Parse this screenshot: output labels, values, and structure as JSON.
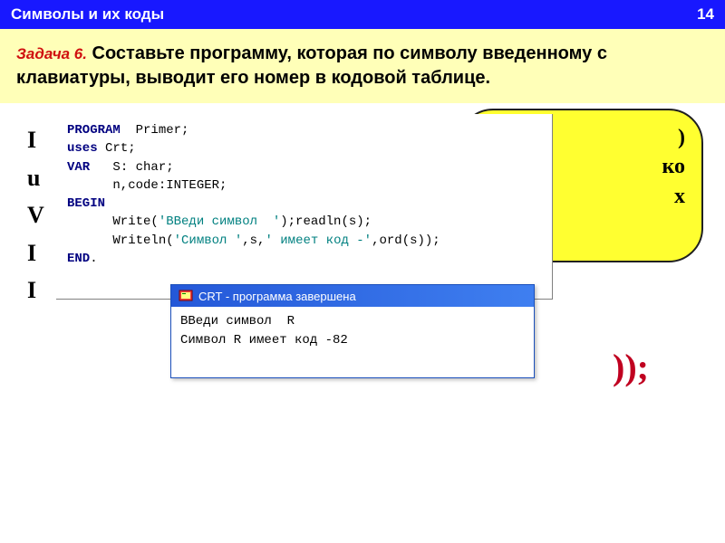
{
  "titleBar": {
    "title": "Символы  и их коды",
    "page": "14"
  },
  "task": {
    "prefix": "Задача 6.",
    "text": " Составьте программу, которая по символу введенному с клавиатуры, выводит его номер в кодовой таблице."
  },
  "behindLeft": {
    "l1": "I",
    "l2": "u",
    "l3": "V",
    "l4": "",
    "l5": "I",
    "l6": "",
    "l7": "I"
  },
  "bubble": {
    "l1": ")",
    "l2": "ко",
    "l3": "",
    "l4": "х"
  },
  "paren": "));",
  "code": {
    "line1_kw": "PROGRAM",
    "line1_rest": "  Primer;",
    "line2_kw": "uses",
    "line2_rest": " Crt;",
    "line3_kw": "VAR",
    "line3_rest": "   S: char;",
    "line4": "      n,code:INTEGER;",
    "line5_kw": "BEGIN",
    "line6_a": "      Write(",
    "line6_str": "'ВВеди символ  '",
    "line6_b": ");readln(s);",
    "line7_a": "      Writeln(",
    "line7_str1": "'Символ '",
    "line7_mid": ",s,",
    "line7_str2": "' имеет код -'",
    "line7_b": ",ord(s));",
    "line8_kw": "END",
    "line8_rest": "."
  },
  "crt": {
    "title": "CRT - программа завершена",
    "line1": "ВВеди символ  R",
    "line2": "Символ R имеет код -82"
  }
}
